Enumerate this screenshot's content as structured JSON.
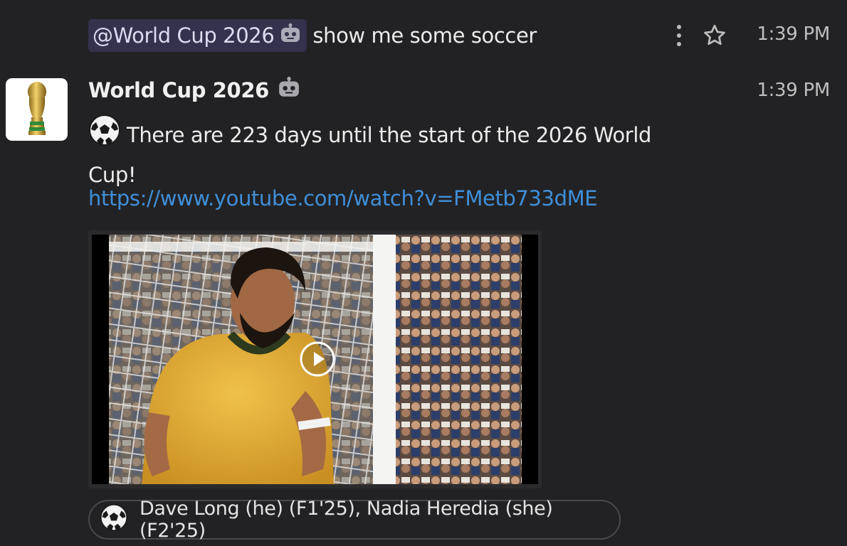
{
  "prompt_message": {
    "mention": "@World Cup 2026",
    "text": "show me some soccer",
    "time": "1:39 PM"
  },
  "bot_message": {
    "author": "World Cup 2026",
    "time": "1:39 PM",
    "text": "There are 223 days until the start of the 2026 World Cup!",
    "link": "https://www.youtube.com/watch?v=FMetb733dME"
  },
  "reaction": {
    "emoji": "soccer-ball",
    "users": "Dave Long (he) (F1'25), Nadia Heredia (she) (F2'25)"
  },
  "colors": {
    "background": "#222224",
    "mention_bg": "#34324d",
    "link": "#3f8fd9"
  }
}
